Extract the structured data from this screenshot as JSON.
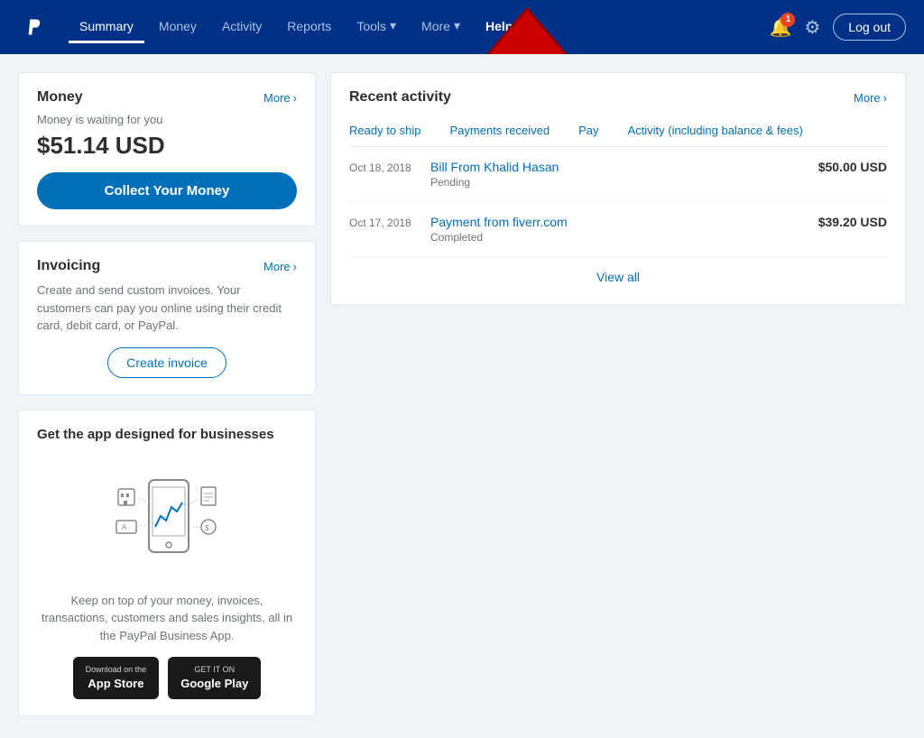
{
  "navbar": {
    "logo_alt": "PayPal",
    "nav_items": [
      {
        "id": "summary",
        "label": "Summary",
        "active": true
      },
      {
        "id": "money",
        "label": "Money",
        "active": false
      },
      {
        "id": "activity",
        "label": "Activity",
        "active": false
      },
      {
        "id": "reports",
        "label": "Reports",
        "active": false
      },
      {
        "id": "tools",
        "label": "Tools",
        "active": false,
        "arrow": true
      },
      {
        "id": "more",
        "label": "More",
        "active": false,
        "arrow": true
      },
      {
        "id": "help",
        "label": "Help",
        "active": false,
        "highlight": true
      }
    ],
    "notification_count": "1",
    "logout_label": "Log out"
  },
  "money_card": {
    "title": "Money",
    "more_label": "More",
    "subtitle": "Money is waiting for you",
    "balance": "$51.14 USD",
    "collect_btn": "Collect Your Money"
  },
  "invoicing_card": {
    "title": "Invoicing",
    "more_label": "More",
    "description": "Create and send custom invoices. Your customers can pay you online using their credit card, debit card, or PayPal.",
    "create_btn": "Create invoice"
  },
  "app_card": {
    "title": "Get the app designed for businesses",
    "description": "Keep on top of your money, invoices, transactions, customers and sales insights, all in the PayPal Business App.",
    "appstore_label": "Download on the",
    "appstore_name": "App Store",
    "googleplay_label": "GET IT ON",
    "googleplay_name": "Google Play"
  },
  "activity": {
    "title": "Recent activity",
    "more_label": "More",
    "tabs": [
      {
        "id": "ready-to-ship",
        "label": "Ready to ship",
        "active": false
      },
      {
        "id": "payments-received",
        "label": "Payments received",
        "active": false
      },
      {
        "id": "pay",
        "label": "Pay",
        "active": false
      },
      {
        "id": "activity-fees",
        "label": "Activity (including balance & fees)",
        "active": false
      }
    ],
    "rows": [
      {
        "date": "Oct 18, 2018",
        "name": "Bill From Khalid Hasan",
        "status": "Pending",
        "amount": "$50.00 USD"
      },
      {
        "date": "Oct 17, 2018",
        "name": "Payment from fiverr.com",
        "status": "Completed",
        "amount": "$39.20 USD"
      }
    ],
    "view_all": "View all"
  }
}
